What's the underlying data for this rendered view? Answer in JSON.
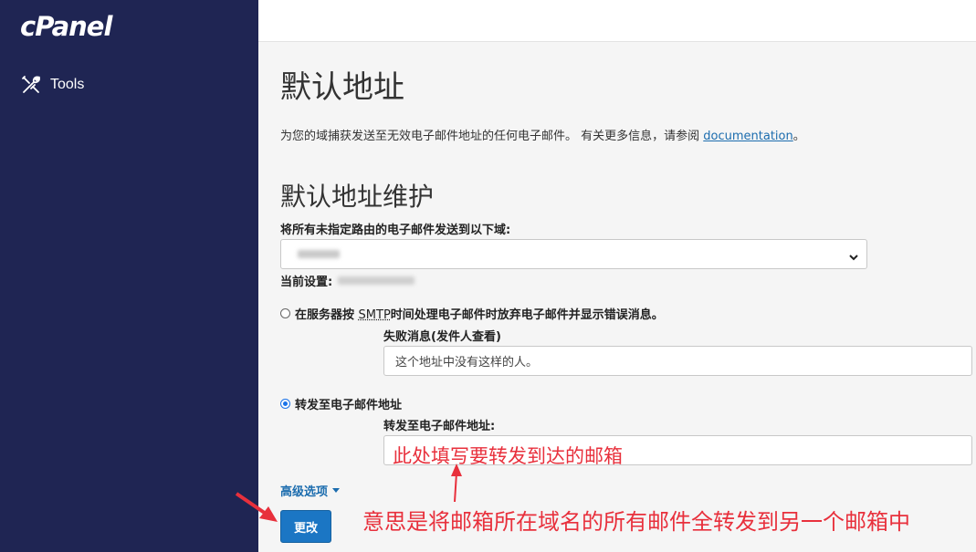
{
  "sidebar": {
    "logo": "cPanel",
    "items": [
      {
        "label": "Tools",
        "icon": "tools-icon"
      }
    ]
  },
  "page": {
    "title": "默认地址",
    "description": "为您的域捕获发送至无效电子邮件地址的任何电子邮件。 有关更多信息，请参阅 ",
    "doc_link": "documentation",
    "doc_suffix": "。"
  },
  "maintenance": {
    "title": "默认地址维护",
    "domain_label": "将所有未指定路由的电子邮件发送到以下域:",
    "current_setting_label": "当前设置:",
    "options": {
      "discard_pre": "在服务器按 ",
      "discard_smtp": "SMTP",
      "discard_post": "时间处理电子邮件时放弃电子邮件并显示错误消息。",
      "discard_checked": false,
      "failure_label": "失败消息(发件人查看)",
      "failure_value": "这个地址中没有这样的人。",
      "forward_label": "转发至电子邮件地址",
      "forward_checked": true,
      "forward_address_label": "转发至电子邮件地址:",
      "forward_address_value": ""
    },
    "advanced_label": "高级选项",
    "submit_label": "更改"
  },
  "annotations": {
    "input_hint": "此处填写要转发到达的邮箱",
    "bottom_hint": "意思是将邮箱所在域名的所有邮件全转发到另一个邮箱中",
    "color": "#e8303c"
  },
  "colors": {
    "sidebar_bg": "#1f2553",
    "primary_button": "#1b76c4",
    "link": "#1b6cae"
  }
}
